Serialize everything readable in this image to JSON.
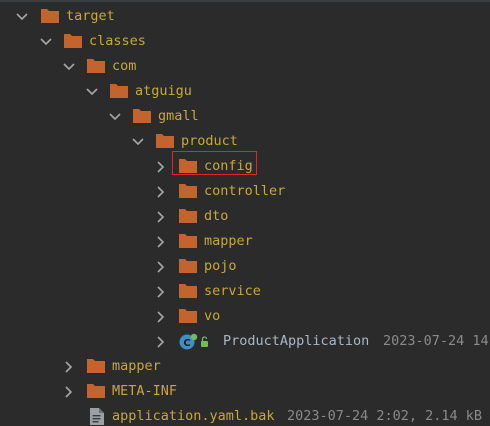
{
  "colors": {
    "background": "#2b2b2b",
    "folder": "#c3642f",
    "text_excluded": "#c8a838",
    "text_normal": "#a9b7c6",
    "meta": "#8a8a8a",
    "highlight": "#e0262b",
    "chevron": "#a6a6a6",
    "app_icon": "#3d8fc6"
  },
  "tree": {
    "target": {
      "label": "target",
      "expanded": true
    },
    "classes": {
      "label": "classes",
      "expanded": true
    },
    "com": {
      "label": "com",
      "expanded": true
    },
    "atguigu": {
      "label": "atguigu",
      "expanded": true
    },
    "gmall": {
      "label": "gmall",
      "expanded": true
    },
    "product": {
      "label": "product",
      "expanded": true
    },
    "config": {
      "label": "config",
      "expanded": false,
      "highlighted": true
    },
    "controller": {
      "label": "controller",
      "expanded": false
    },
    "dto": {
      "label": "dto",
      "expanded": false
    },
    "mapper_inner": {
      "label": "mapper",
      "expanded": false
    },
    "pojo": {
      "label": "pojo",
      "expanded": false
    },
    "service": {
      "label": "service",
      "expanded": false
    },
    "vo": {
      "label": "vo",
      "expanded": false
    },
    "product_application": {
      "label": "ProductApplication",
      "meta": "2023-07-24 14",
      "icon": "spring-boot-class-icon"
    },
    "mapper_outer": {
      "label": "mapper",
      "expanded": false
    },
    "meta_inf": {
      "label": "META-INF",
      "expanded": false
    },
    "application_yaml_bak": {
      "label": "application.yaml.bak",
      "meta": "2023-07-24 2:02, 2.14 kB",
      "icon": "text-file-icon"
    }
  }
}
